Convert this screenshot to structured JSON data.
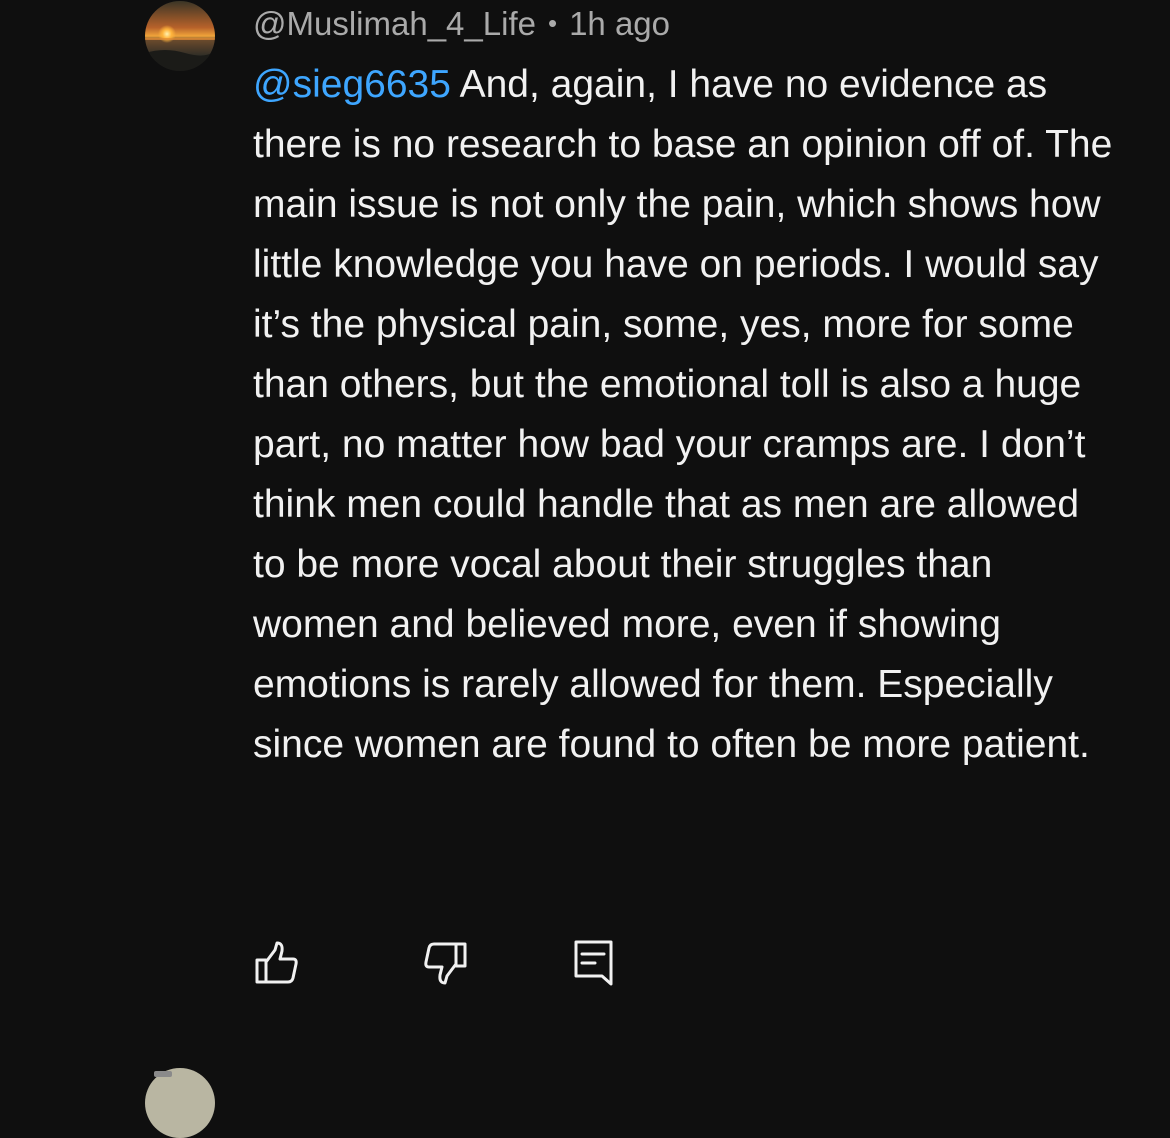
{
  "comment": {
    "author": "@Muslimah_4_Life",
    "separator": "•",
    "time": "1h ago",
    "mention": "@sieg6635",
    "text": " And, again, I have no evidence as there is no research to base an opinion off of. The main issue is not only the pain, which shows how little knowledge you have on periods. I would say it’s the physical pain, some, yes, more for some than others, but the emotional toll is also a huge part, no matter how bad your cramps are. I don’t think men could handle that as men are allowed to be more vocal about their struggles than women and believed more, even if showing emotions is rarely allowed for them. Especially since women are found to often be more patient.",
    "avatar_icon": "sunset-avatar",
    "actions": {
      "like_icon": "thumbs-up-icon",
      "dislike_icon": "thumbs-down-icon",
      "reply_icon": "reply-comment-icon"
    }
  },
  "colors": {
    "background": "#0f0f0f",
    "text": "#f1f1f1",
    "meta": "#aaaaaa",
    "mention": "#3ea6ff"
  }
}
